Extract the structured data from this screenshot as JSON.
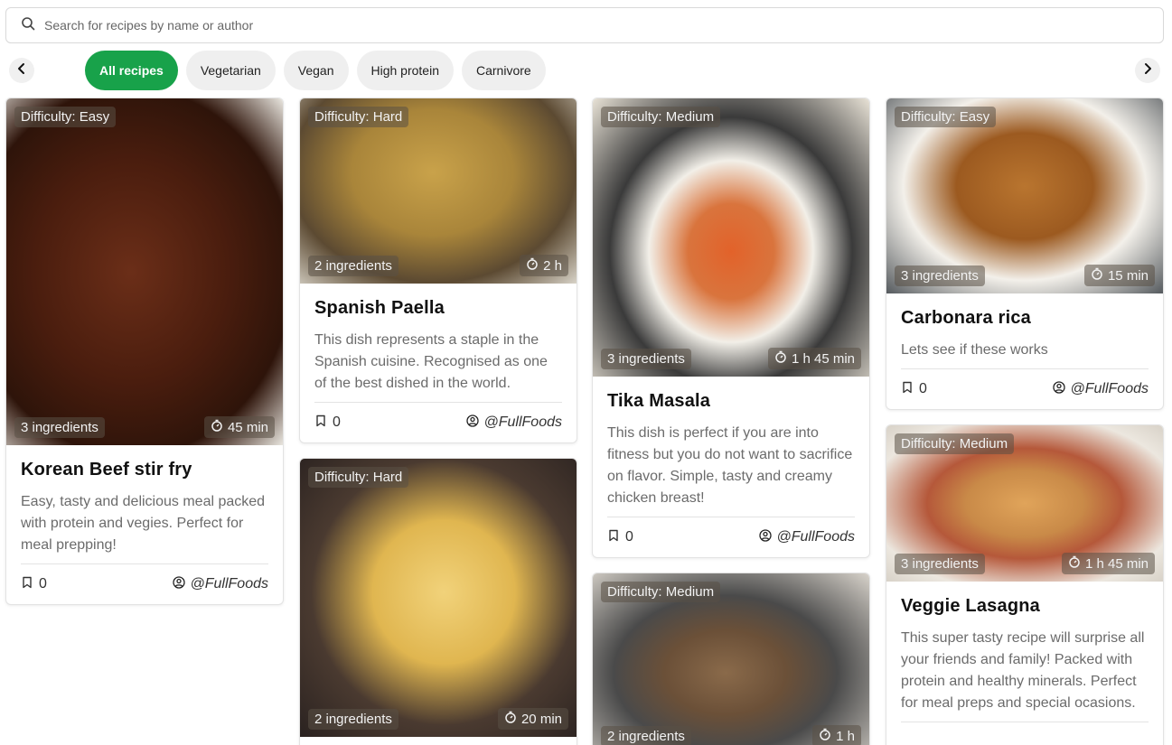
{
  "search": {
    "placeholder": "Search for recipes by name or author",
    "value": ""
  },
  "filters": [
    "All recipes",
    "Vegetarian",
    "Vegan",
    "High protein",
    "Carnivore"
  ],
  "colors": {
    "accent": "#18a24a"
  },
  "icons": [
    "search-icon",
    "chevron-left-icon",
    "chevron-right-icon",
    "bookmark-icon",
    "user-circle-icon",
    "timer-icon"
  ],
  "recipes": [
    {
      "difficulty": "Difficulty: Easy",
      "ingredients": "3 ingredients",
      "time": "45 min",
      "title": "Korean Beef stir fry",
      "description": "Easy, tasty and delicious meal packed with protein and vegies. Perfect for meal prepping!",
      "saves": "0",
      "author": "@FullFoods"
    },
    {
      "difficulty": "Difficulty: Hard",
      "ingredients": "2 ingredients",
      "time": "2 h",
      "title": "Spanish Paella",
      "description": "This dish represents a staple in the Spanish cuisine. Recognised as one of the best dished in the world.",
      "saves": "0",
      "author": "@FullFoods"
    },
    {
      "difficulty": "Difficulty: Hard",
      "ingredients": "2 ingredients",
      "time": "20 min"
    },
    {
      "difficulty": "Difficulty: Medium",
      "ingredients": "3 ingredients",
      "time": "1 h 45 min",
      "title": "Tika Masala",
      "description": "This dish is perfect if you are into fitness but you do not want to sacrifice on flavor. Simple, tasty and creamy chicken breast!",
      "saves": "0",
      "author": "@FullFoods"
    },
    {
      "difficulty": "Difficulty: Medium",
      "ingredients": "2 ingredients",
      "time": "1 h"
    },
    {
      "difficulty": "Difficulty: Easy",
      "ingredients": "3 ingredients",
      "time": "15 min",
      "title": "Carbonara rica",
      "description": "Lets see if these works",
      "saves": "0",
      "author": "@FullFoods"
    },
    {
      "difficulty": "Difficulty: Medium",
      "ingredients": "3 ingredients",
      "time": "1 h 45 min",
      "title": "Veggie Lasagna",
      "description": "This super tasty recipe will surprise all your friends and family! Packed with protein and healthy minerals. Perfect for meal preps and special ocasions."
    }
  ]
}
